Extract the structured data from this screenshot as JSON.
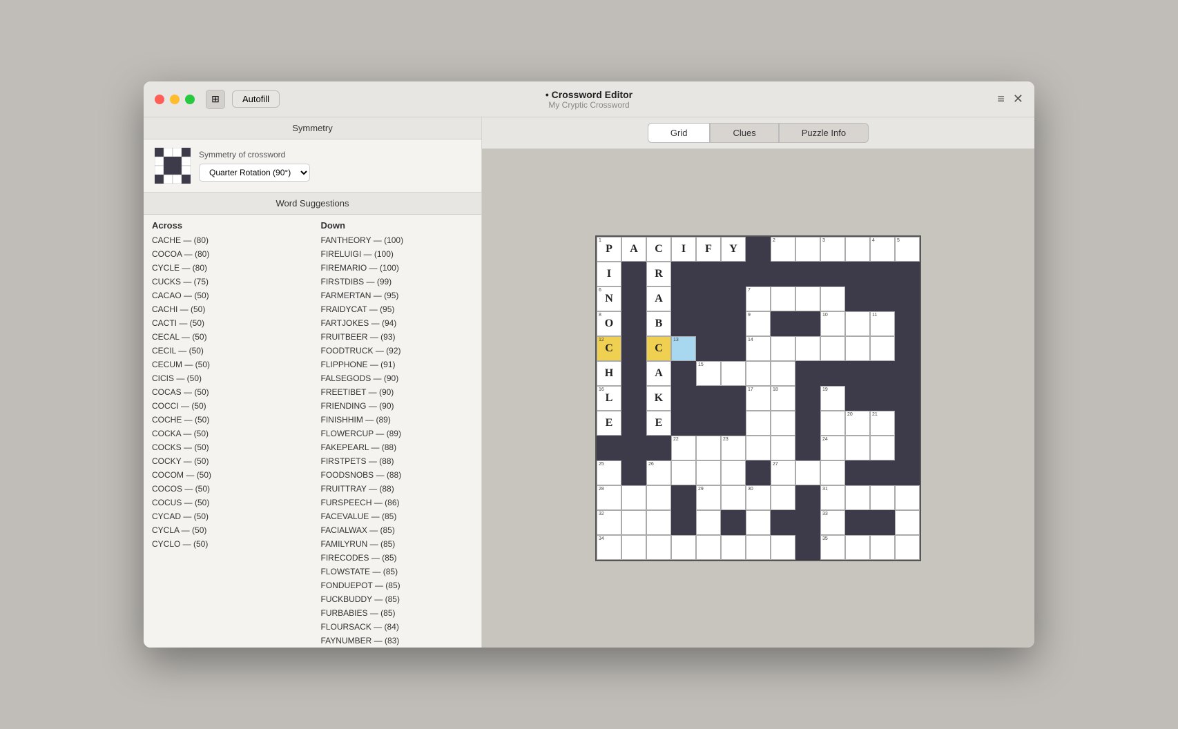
{
  "window": {
    "title": "Crossword Editor",
    "doc_title": "My Cryptic Crossword"
  },
  "titlebar": {
    "sidebar_toggle_icon": "⊞",
    "autofill_label": "Autofill",
    "hamburger_icon": "≡",
    "close_icon": "✕"
  },
  "tabs": [
    {
      "id": "grid",
      "label": "Grid",
      "active": true
    },
    {
      "id": "clues",
      "label": "Clues",
      "active": false
    },
    {
      "id": "puzzle-info",
      "label": "Puzzle Info",
      "active": false
    }
  ],
  "sidebar": {
    "symmetry_header": "Symmetry",
    "symmetry_label": "Symmetry of crossword",
    "symmetry_dropdown": "Quarter Rotation (90°)",
    "word_suggestions_header": "Word Suggestions",
    "across_header": "Across",
    "down_header": "Down",
    "across_items": [
      "CACHE — (80)",
      "COCOA — (80)",
      "CYCLE — (80)",
      "CUCKS — (75)",
      "CACAO — (50)",
      "CACHI — (50)",
      "CACTI — (50)",
      "CECAL — (50)",
      "CECIL — (50)",
      "CECUM — (50)",
      "CICIS — (50)",
      "COCAS — (50)",
      "COCCI — (50)",
      "COCHE — (50)",
      "COCKA — (50)",
      "COCKS — (50)",
      "COCKY — (50)",
      "COCOM — (50)",
      "COCOS — (50)",
      "COCUS — (50)",
      "CYCAD — (50)",
      "CYCLA — (50)",
      "CYCLO — (50)"
    ],
    "down_items": [
      "FANTHEORY — (100)",
      "FIRELUIGI — (100)",
      "FIREMARIO — (100)",
      "FIRSTDIBS — (99)",
      "FARMERTAN — (95)",
      "FRAIDYCAT — (95)",
      "FARTJOKES — (94)",
      "FRUITBEER — (93)",
      "FOODTRUCK — (92)",
      "FLIPPHONE — (91)",
      "FALSEGODS — (90)",
      "FREETIBET — (90)",
      "FRIENDING — (90)",
      "FINISHHIM — (89)",
      "FLOWERCUP — (89)",
      "FAKEPEARL — (88)",
      "FIRSTPETS — (88)",
      "FOODSNOBS — (88)",
      "FRUITTRAY — (88)",
      "FURSPEECH — (86)",
      "FACEVALUE — (85)",
      "FACIALWAX — (85)",
      "FAMILYRUN — (85)",
      "FIRECODES — (85)",
      "FLOWSTATE — (85)",
      "FONDUEPOT — (85)",
      "FUCKBUDDY — (85)",
      "FURBABIES — (85)",
      "FLOURSACK — (84)",
      "FAYNUMBER — (83)"
    ]
  },
  "grid": {
    "size": 13,
    "cells": [
      [
        {
          "type": "white",
          "number": "1",
          "letter": "P"
        },
        {
          "type": "white",
          "number": "",
          "letter": "A"
        },
        {
          "type": "white",
          "number": "",
          "letter": "C"
        },
        {
          "type": "white",
          "number": "",
          "letter": "I"
        },
        {
          "type": "white",
          "number": "",
          "letter": "F"
        },
        {
          "type": "white",
          "number": "",
          "letter": "Y"
        },
        {
          "type": "black"
        },
        {
          "type": "white",
          "number": "2",
          "letter": ""
        },
        {
          "type": "white",
          "number": "",
          "letter": ""
        },
        {
          "type": "white",
          "number": "3",
          "letter": ""
        },
        {
          "type": "white",
          "number": "",
          "letter": ""
        },
        {
          "type": "white",
          "number": "4",
          "letter": ""
        },
        {
          "type": "white",
          "number": "5",
          "letter": ""
        }
      ],
      [
        {
          "type": "white",
          "number": "",
          "letter": "I"
        },
        {
          "type": "black"
        },
        {
          "type": "white",
          "number": "",
          "letter": "R"
        },
        {
          "type": "black"
        },
        {
          "type": "black"
        },
        {
          "type": "black"
        },
        {
          "type": "black"
        },
        {
          "type": "black"
        },
        {
          "type": "black"
        },
        {
          "type": "black"
        },
        {
          "type": "black"
        },
        {
          "type": "black"
        },
        {
          "type": "black"
        }
      ],
      [
        {
          "type": "white",
          "number": "6",
          "letter": "N"
        },
        {
          "type": "black"
        },
        {
          "type": "white",
          "number": "",
          "letter": "A"
        },
        {
          "type": "black"
        },
        {
          "type": "black"
        },
        {
          "type": "black"
        },
        {
          "type": "white",
          "number": "7",
          "letter": ""
        },
        {
          "type": "white",
          "number": "",
          "letter": ""
        },
        {
          "type": "white",
          "number": "",
          "letter": ""
        },
        {
          "type": "white",
          "number": "",
          "letter": ""
        },
        {
          "type": "black"
        },
        {
          "type": "black"
        },
        {
          "type": "black"
        }
      ],
      [
        {
          "type": "white",
          "number": "8",
          "letter": "O"
        },
        {
          "type": "black"
        },
        {
          "type": "white",
          "number": "",
          "letter": "B"
        },
        {
          "type": "black"
        },
        {
          "type": "black"
        },
        {
          "type": "black"
        },
        {
          "type": "white",
          "number": "9",
          "letter": ""
        },
        {
          "type": "black"
        },
        {
          "type": "black"
        },
        {
          "type": "white",
          "number": "10",
          "letter": ""
        },
        {
          "type": "white",
          "number": "",
          "letter": ""
        },
        {
          "type": "white",
          "number": "11",
          "letter": ""
        },
        {
          "type": "black"
        }
      ],
      [
        {
          "type": "yellow",
          "number": "12",
          "letter": "C"
        },
        {
          "type": "black"
        },
        {
          "type": "yellow",
          "number": "",
          "letter": "C"
        },
        {
          "type": "blue",
          "number": "13",
          "letter": ""
        },
        {
          "type": "black"
        },
        {
          "type": "black"
        },
        {
          "type": "white",
          "number": "14",
          "letter": ""
        },
        {
          "type": "white",
          "number": "",
          "letter": ""
        },
        {
          "type": "white",
          "number": "",
          "letter": ""
        },
        {
          "type": "white",
          "number": "",
          "letter": ""
        },
        {
          "type": "white",
          "number": "",
          "letter": ""
        },
        {
          "type": "white",
          "number": "",
          "letter": ""
        },
        {
          "type": "black"
        }
      ],
      [
        {
          "type": "white",
          "number": "",
          "letter": "H"
        },
        {
          "type": "black"
        },
        {
          "type": "white",
          "number": "",
          "letter": "A"
        },
        {
          "type": "black"
        },
        {
          "type": "white",
          "number": "15",
          "letter": ""
        },
        {
          "type": "white",
          "number": "",
          "letter": ""
        },
        {
          "type": "white",
          "number": "",
          "letter": ""
        },
        {
          "type": "white",
          "number": "",
          "letter": ""
        },
        {
          "type": "black"
        },
        {
          "type": "black"
        },
        {
          "type": "black"
        },
        {
          "type": "black"
        },
        {
          "type": "black"
        }
      ],
      [
        {
          "type": "white",
          "number": "16",
          "letter": "L"
        },
        {
          "type": "black"
        },
        {
          "type": "white",
          "number": "",
          "letter": "K"
        },
        {
          "type": "black"
        },
        {
          "type": "black"
        },
        {
          "type": "black"
        },
        {
          "type": "white",
          "number": "17",
          "letter": ""
        },
        {
          "type": "white",
          "number": "18",
          "letter": ""
        },
        {
          "type": "black"
        },
        {
          "type": "white",
          "number": "19",
          "letter": ""
        },
        {
          "type": "black"
        },
        {
          "type": "black"
        },
        {
          "type": "black"
        }
      ],
      [
        {
          "type": "white",
          "number": "",
          "letter": "E"
        },
        {
          "type": "black"
        },
        {
          "type": "white",
          "number": "",
          "letter": "E"
        },
        {
          "type": "black"
        },
        {
          "type": "black"
        },
        {
          "type": "black"
        },
        {
          "type": "white",
          "number": "",
          "letter": ""
        },
        {
          "type": "white",
          "number": "",
          "letter": ""
        },
        {
          "type": "black"
        },
        {
          "type": "white",
          "number": "",
          "letter": ""
        },
        {
          "type": "white",
          "number": "20",
          "letter": ""
        },
        {
          "type": "white",
          "number": "21",
          "letter": ""
        },
        {
          "type": "black"
        }
      ],
      [
        {
          "type": "black"
        },
        {
          "type": "black"
        },
        {
          "type": "black"
        },
        {
          "type": "white",
          "number": "22",
          "letter": ""
        },
        {
          "type": "white",
          "number": "",
          "letter": ""
        },
        {
          "type": "white",
          "number": "23",
          "letter": ""
        },
        {
          "type": "white",
          "number": "",
          "letter": ""
        },
        {
          "type": "white",
          "number": "",
          "letter": ""
        },
        {
          "type": "black"
        },
        {
          "type": "white",
          "number": "24",
          "letter": ""
        },
        {
          "type": "white",
          "number": "",
          "letter": ""
        },
        {
          "type": "white",
          "number": "",
          "letter": ""
        },
        {
          "type": "black"
        }
      ],
      [
        {
          "type": "white",
          "number": "25",
          "letter": ""
        },
        {
          "type": "black"
        },
        {
          "type": "white",
          "number": "26",
          "letter": ""
        },
        {
          "type": "white",
          "number": "",
          "letter": ""
        },
        {
          "type": "white",
          "number": "",
          "letter": ""
        },
        {
          "type": "white",
          "number": "",
          "letter": ""
        },
        {
          "type": "black"
        },
        {
          "type": "white",
          "number": "27",
          "letter": ""
        },
        {
          "type": "white",
          "number": "",
          "letter": ""
        },
        {
          "type": "white",
          "number": "",
          "letter": ""
        },
        {
          "type": "black"
        },
        {
          "type": "black"
        },
        {
          "type": "black"
        }
      ],
      [
        {
          "type": "white",
          "number": "28",
          "letter": ""
        },
        {
          "type": "white",
          "number": "",
          "letter": ""
        },
        {
          "type": "white",
          "number": "",
          "letter": ""
        },
        {
          "type": "black"
        },
        {
          "type": "white",
          "number": "29",
          "letter": ""
        },
        {
          "type": "white",
          "number": "",
          "letter": ""
        },
        {
          "type": "white",
          "number": "30",
          "letter": ""
        },
        {
          "type": "white",
          "number": "",
          "letter": ""
        },
        {
          "type": "black"
        },
        {
          "type": "white",
          "number": "31",
          "letter": ""
        },
        {
          "type": "white",
          "number": "",
          "letter": ""
        },
        {
          "type": "white",
          "number": "",
          "letter": ""
        },
        {
          "type": "white",
          "number": "",
          "letter": ""
        }
      ],
      [
        {
          "type": "white",
          "number": "32",
          "letter": ""
        },
        {
          "type": "white",
          "number": "",
          "letter": ""
        },
        {
          "type": "white",
          "number": "",
          "letter": ""
        },
        {
          "type": "black"
        },
        {
          "type": "white",
          "number": "",
          "letter": ""
        },
        {
          "type": "black"
        },
        {
          "type": "white",
          "number": "",
          "letter": ""
        },
        {
          "type": "black"
        },
        {
          "type": "black"
        },
        {
          "type": "white",
          "number": "33",
          "letter": ""
        },
        {
          "type": "black"
        },
        {
          "type": "black"
        },
        {
          "type": "white",
          "number": "",
          "letter": ""
        }
      ],
      [
        {
          "type": "white",
          "number": "34",
          "letter": ""
        },
        {
          "type": "white",
          "number": "",
          "letter": ""
        },
        {
          "type": "white",
          "number": "",
          "letter": ""
        },
        {
          "type": "white",
          "number": "",
          "letter": ""
        },
        {
          "type": "white",
          "number": "",
          "letter": ""
        },
        {
          "type": "white",
          "number": "",
          "letter": ""
        },
        {
          "type": "white",
          "number": "",
          "letter": ""
        },
        {
          "type": "white",
          "number": "",
          "letter": ""
        },
        {
          "type": "black"
        },
        {
          "type": "white",
          "number": "35",
          "letter": ""
        },
        {
          "type": "white",
          "number": "",
          "letter": ""
        },
        {
          "type": "white",
          "number": "",
          "letter": ""
        },
        {
          "type": "white",
          "number": "",
          "letter": ""
        }
      ]
    ]
  }
}
